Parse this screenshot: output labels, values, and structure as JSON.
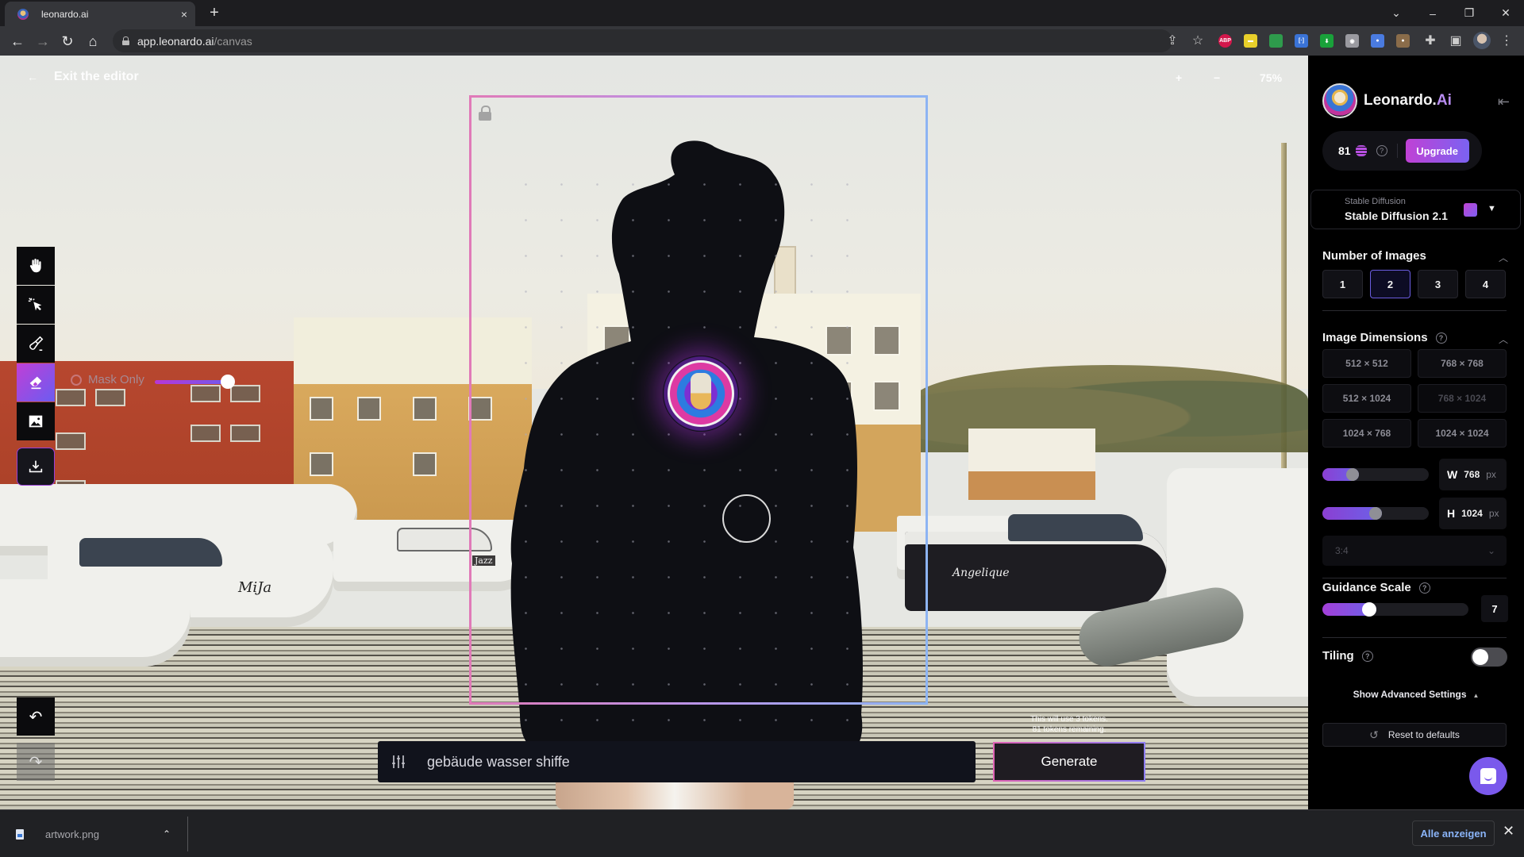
{
  "browser": {
    "tab_title": "leonardo.ai",
    "tab_close": "×",
    "new_tab": "+",
    "url_host": "app.leonardo.ai",
    "url_path": "/canvas",
    "window_controls": {
      "tabs_menu": "⌄",
      "minimize": "–",
      "restore": "❐",
      "close": "✕"
    },
    "nav": {
      "back": "←",
      "forward": "→",
      "reload": "↻",
      "home": "⌂"
    },
    "extensions": [
      {
        "name": "adblock-plus",
        "label": "ABP",
        "color": "#d2174b"
      },
      {
        "name": "extension-yellow",
        "label": "▬",
        "color": "#e8cf2a"
      },
      {
        "name": "extension-rainbow",
        "label": "",
        "color": "#2e9b4c"
      },
      {
        "name": "extension-tag",
        "label": "[·]",
        "color": "#3a73d6"
      },
      {
        "name": "extension-download",
        "label": "⬇",
        "color": "#19a13a"
      },
      {
        "name": "extension-camera",
        "label": "◉",
        "color": "#9a9aa0"
      },
      {
        "name": "extension-globe",
        "label": "●",
        "color": "#4a7be0"
      },
      {
        "name": "extension-cookie",
        "label": "●",
        "color": "#8a6c4a"
      }
    ]
  },
  "editor": {
    "exit_label": "Exit the editor",
    "exit_arrow": "←",
    "zoom_in": "+",
    "zoom_out": "−",
    "zoom_level": "75%",
    "mask_only_label": "Mask Only",
    "brush_size_fraction": 1.0,
    "tools": [
      {
        "name": "pan-tool",
        "icon": "hand-icon"
      },
      {
        "name": "select-tool",
        "icon": "pointer-click-icon"
      },
      {
        "name": "draw-mask-tool",
        "icon": "paintbrush-icon"
      },
      {
        "name": "erase-tool",
        "icon": "eraser-icon",
        "active": true
      },
      {
        "name": "upload-image-tool",
        "icon": "image-icon"
      },
      {
        "name": "download-tool",
        "icon": "download-icon"
      }
    ],
    "undo_label": "↶",
    "redo_label": "↷",
    "boat_names": [
      "MiJa",
      "Angelique",
      "Jazz"
    ],
    "prompt_value": "gebäude wasser shiffe",
    "token_note_line1": "This will use 3 tokens.",
    "token_note_line2": "81 tokens remaining.",
    "generate_label": "Generate"
  },
  "panel": {
    "brand_name": "Leonardo.",
    "brand_suffix": "Ai",
    "collapse_icon": "⇤",
    "credits": "81",
    "upgrade_label": "Upgrade",
    "model_category": "Stable Diffusion",
    "model_value": "Stable Diffusion 2.1",
    "num_images_title": "Number of Images",
    "num_images_options": [
      "1",
      "2",
      "3",
      "4"
    ],
    "num_images_selected": "2",
    "dimensions_title": "Image Dimensions",
    "dimension_options": [
      {
        "label": "512 × 512",
        "disabled": false
      },
      {
        "label": "768 × 768",
        "disabled": false
      },
      {
        "label": "512 × 1024",
        "disabled": false
      },
      {
        "label": "768 × 1024",
        "disabled": true
      },
      {
        "label": "1024 × 768",
        "disabled": false
      },
      {
        "label": "1024 × 1024",
        "disabled": false
      }
    ],
    "width_axis": "W",
    "width_value": "768",
    "width_fraction": 0.25,
    "height_axis": "H",
    "height_value": "1024",
    "height_fraction": 0.5,
    "unit": "px",
    "aspect_ratio": "3:4",
    "guidance_title": "Guidance Scale",
    "guidance_value": "7",
    "guidance_fraction": 0.3,
    "tiling_title": "Tiling",
    "tiling_on": false,
    "advanced_label": "Show Advanced Settings",
    "advanced_icon": "▲",
    "reset_label": "Reset to defaults",
    "reset_icon": "↺",
    "help_icon": "?"
  },
  "downloads": {
    "file_name": "artwork.png",
    "chevron": "⌃",
    "show_all_label": "Alle anzeigen",
    "close": "✕"
  },
  "colors": {
    "accent_purple": "#7b62f2",
    "accent_magenta": "#c041d5",
    "panel_bg": "#000000",
    "link_blue": "#8ab4f8"
  }
}
